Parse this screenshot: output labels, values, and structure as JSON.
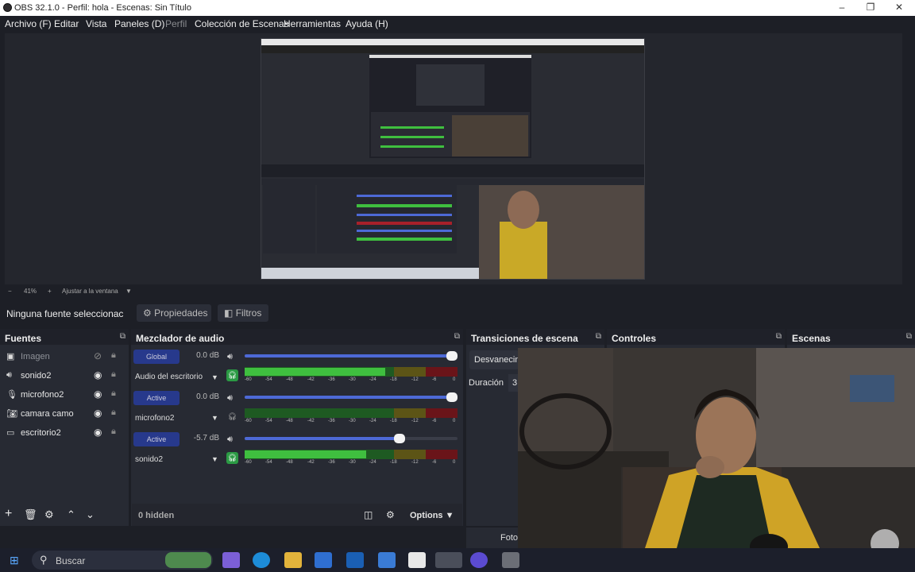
{
  "window": {
    "title": "OBS 32.1.0 - Perfil: hola - Escenas: Sin Título"
  },
  "menu": [
    "Archivo (F)",
    "Editar",
    "Vista",
    "Paneles (D)",
    "Perfil",
    "Colección de Escenas",
    "Herramientas",
    "Ayuda (H)"
  ],
  "zoom": {
    "minus": "−",
    "value": "41%",
    "plus": "+",
    "fit": "Ajustar a la ventana",
    "arrow": "▼"
  },
  "source_toolbar": {
    "selection": "Ninguna fuente seleccionac",
    "properties": "Propiedades",
    "filters": "Filtros"
  },
  "sources": {
    "title": "Fuentes",
    "items": [
      {
        "name": "Imagen",
        "icon": "image-icon",
        "visible": false
      },
      {
        "name": "sonido2",
        "icon": "speaker-icon",
        "visible": true
      },
      {
        "name": "microfono2",
        "icon": "microphone-icon",
        "visible": true
      },
      {
        "name": "camara camo",
        "icon": "camera-icon",
        "visible": true
      },
      {
        "name": "escritorio2",
        "icon": "monitor-icon",
        "visible": true
      }
    ]
  },
  "mixer": {
    "title": "Mezclador de audio",
    "ticks": [
      "-60",
      "-54",
      "-48",
      "-42",
      "-36",
      "-30",
      "-24",
      "-18",
      "-12",
      "-6",
      "0"
    ],
    "channels": [
      {
        "badge": "Global",
        "db": "0.0 dB",
        "name": "Audio del escritorio",
        "volume": 1.0,
        "level": 0.66,
        "monitor": "on"
      },
      {
        "badge": "Active",
        "db": "0.0 dB",
        "name": "microfono2",
        "volume": 1.0,
        "level": 0.0,
        "monitor": "off"
      },
      {
        "badge": "Active",
        "db": "-5.7 dB",
        "name": "sonido2",
        "volume": 0.74,
        "level": 0.57,
        "monitor": "on"
      }
    ],
    "hidden": "0 hidden",
    "options": "Options"
  },
  "transitions": {
    "title": "Transiciones de escena",
    "current": "Desvanecim",
    "duration_label": "Duración",
    "duration_value": "3"
  },
  "controls": {
    "title": "Controles"
  },
  "scenes": {
    "title": "Escenas"
  },
  "overlay_text": "Foto",
  "taskbar": {
    "search": "Buscar"
  },
  "colors": {
    "accent": "#4d69d6",
    "badge": "#27398c",
    "meter_green": "#3fbf3f",
    "meter_yellow": "#b2a323",
    "meter_red": "#a8202a"
  }
}
